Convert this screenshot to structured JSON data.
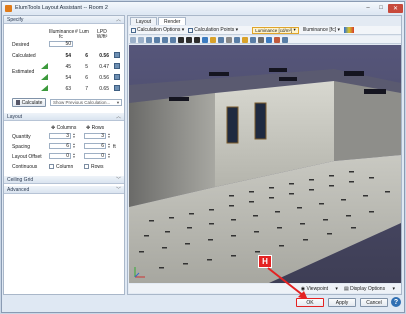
{
  "window": {
    "title": "ElumTools Layout Assistant -- Room 2",
    "close_label": "✕"
  },
  "left": {
    "sections": {
      "specify": "Specify",
      "layout": "Layout",
      "ceiling_grid": "Ceiling Grid",
      "advanced": "Advanced"
    },
    "columns": {
      "illuminance": "Illuminance",
      "fc": "fc",
      "num_lum": "# Lum",
      "lpd": "LPD",
      "lpd_unit": "W/ft²"
    },
    "desired": {
      "label": "Desired",
      "illuminance": "50"
    },
    "calculated": {
      "label": "Calculated",
      "illuminance": "54",
      "num_lum": "6",
      "lpd": "0.56"
    },
    "estimated": {
      "label": "Estimated",
      "rows": [
        {
          "illuminance": "45",
          "num_lum": "5",
          "lpd": "0.47"
        },
        {
          "illuminance": "54",
          "num_lum": "6",
          "lpd": "0.56"
        },
        {
          "illuminance": "63",
          "num_lum": "7",
          "lpd": "0.65"
        }
      ]
    },
    "calculate_button": "Calculate",
    "previous_dropdown": "Show Previous Calculation...",
    "layout": {
      "columns_label": "Columns",
      "rows_label": "Rows",
      "quantity_label": "Quantity",
      "quantity_columns": "3",
      "quantity_rows": "3",
      "spacing_label": "Spacing",
      "spacing_columns": "6",
      "spacing_rows": "6",
      "spacing_unit": "ft",
      "layout_offset_label": "Layout Offset",
      "layout_offset_columns": "0",
      "layout_offset_rows": "0",
      "continuous_label": "Continuous",
      "continuous_columns": "Column",
      "continuous_rows": "Rows"
    }
  },
  "right": {
    "tabs": [
      "Layout",
      "Render"
    ],
    "toolbar": {
      "calc_options": "Calculation Options",
      "calc_points": "Calculation Points",
      "luminance": "Luminance [cd/m²]",
      "illuminance": "Illuminance [fc]"
    },
    "status": {
      "viewpoint": "Viewpoint",
      "display_options": "Display Options"
    }
  },
  "buttons": {
    "ok": "OK",
    "apply": "Apply",
    "cancel": "Cancel",
    "help": "?"
  },
  "callout": {
    "label": "H"
  },
  "colors": {
    "accent": "#e42222",
    "viewport_bg": "#45455e",
    "floor": "#bfbfbb",
    "ok_highlight": "#e42222"
  }
}
